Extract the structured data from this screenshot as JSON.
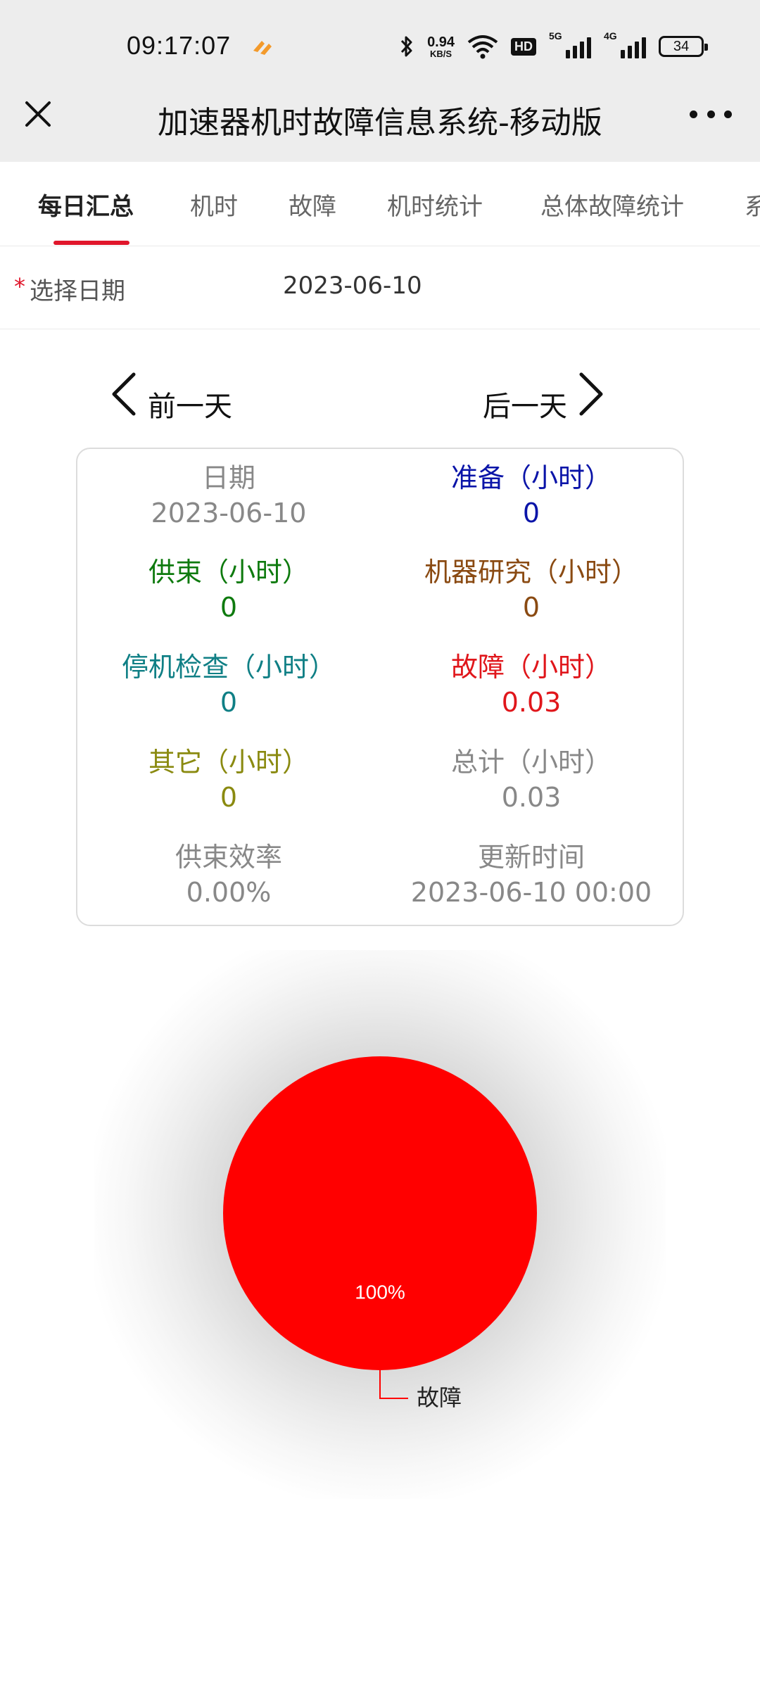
{
  "status_bar": {
    "time": "09:17:07",
    "net_speed_value": "0.94",
    "net_speed_unit": "KB/S",
    "hd_label": "HD",
    "signal1_label": "5G",
    "signal2_label": "4G",
    "battery": "34",
    "icons": [
      "bluetooth-icon",
      "wifi-icon",
      "hd-icon",
      "signal-icon",
      "battery-icon"
    ]
  },
  "app_bar": {
    "title": "加速器机时故障信息系统-移动版",
    "close_icon": "close-icon",
    "more_icon": "more-icon"
  },
  "tabs": [
    {
      "label": "每日汇总",
      "active": true
    },
    {
      "label": "机时",
      "active": false
    },
    {
      "label": "故障",
      "active": false
    },
    {
      "label": "机时统计",
      "active": false
    },
    {
      "label": "总体故障统计",
      "active": false
    },
    {
      "label": "系",
      "active": false
    }
  ],
  "date_picker": {
    "required_mark": "*",
    "label": "选择日期",
    "value": "2023-06-10"
  },
  "navigation": {
    "prev_label": "前一天",
    "next_label": "后一天"
  },
  "summary": {
    "date": {
      "label": "日期",
      "value": "2023-06-10",
      "color": "#888888"
    },
    "prepare": {
      "label": "准备（小时）",
      "value": "0",
      "color": "#0a14a8"
    },
    "beam": {
      "label": "供束（小时）",
      "value": "0",
      "color": "#0e7a0e"
    },
    "machine_study": {
      "label": "机器研究（小时）",
      "value": "0",
      "color": "#8a4a12"
    },
    "shutdown_check": {
      "label": "停机检查（小时）",
      "value": "0",
      "color": "#0f7f85"
    },
    "fault": {
      "label": "故障（小时）",
      "value": "0.03",
      "color": "#e0161b"
    },
    "other": {
      "label": "其它（小时）",
      "value": "0",
      "color": "#8a8a10"
    },
    "total": {
      "label": "总计（小时）",
      "value": "0.03",
      "color": "#888888"
    },
    "efficiency": {
      "label": "供束效率",
      "value": "0.00%",
      "color": "#888888"
    },
    "updated": {
      "label": "更新时间",
      "value": "2023-06-10 00:00",
      "color": "#888888"
    }
  },
  "chart_data": {
    "type": "pie",
    "categories": [
      "故障"
    ],
    "values": [
      100
    ],
    "data_labels": [
      "100%"
    ],
    "colors": [
      "#ff0000"
    ],
    "title": "",
    "legend": "none"
  }
}
